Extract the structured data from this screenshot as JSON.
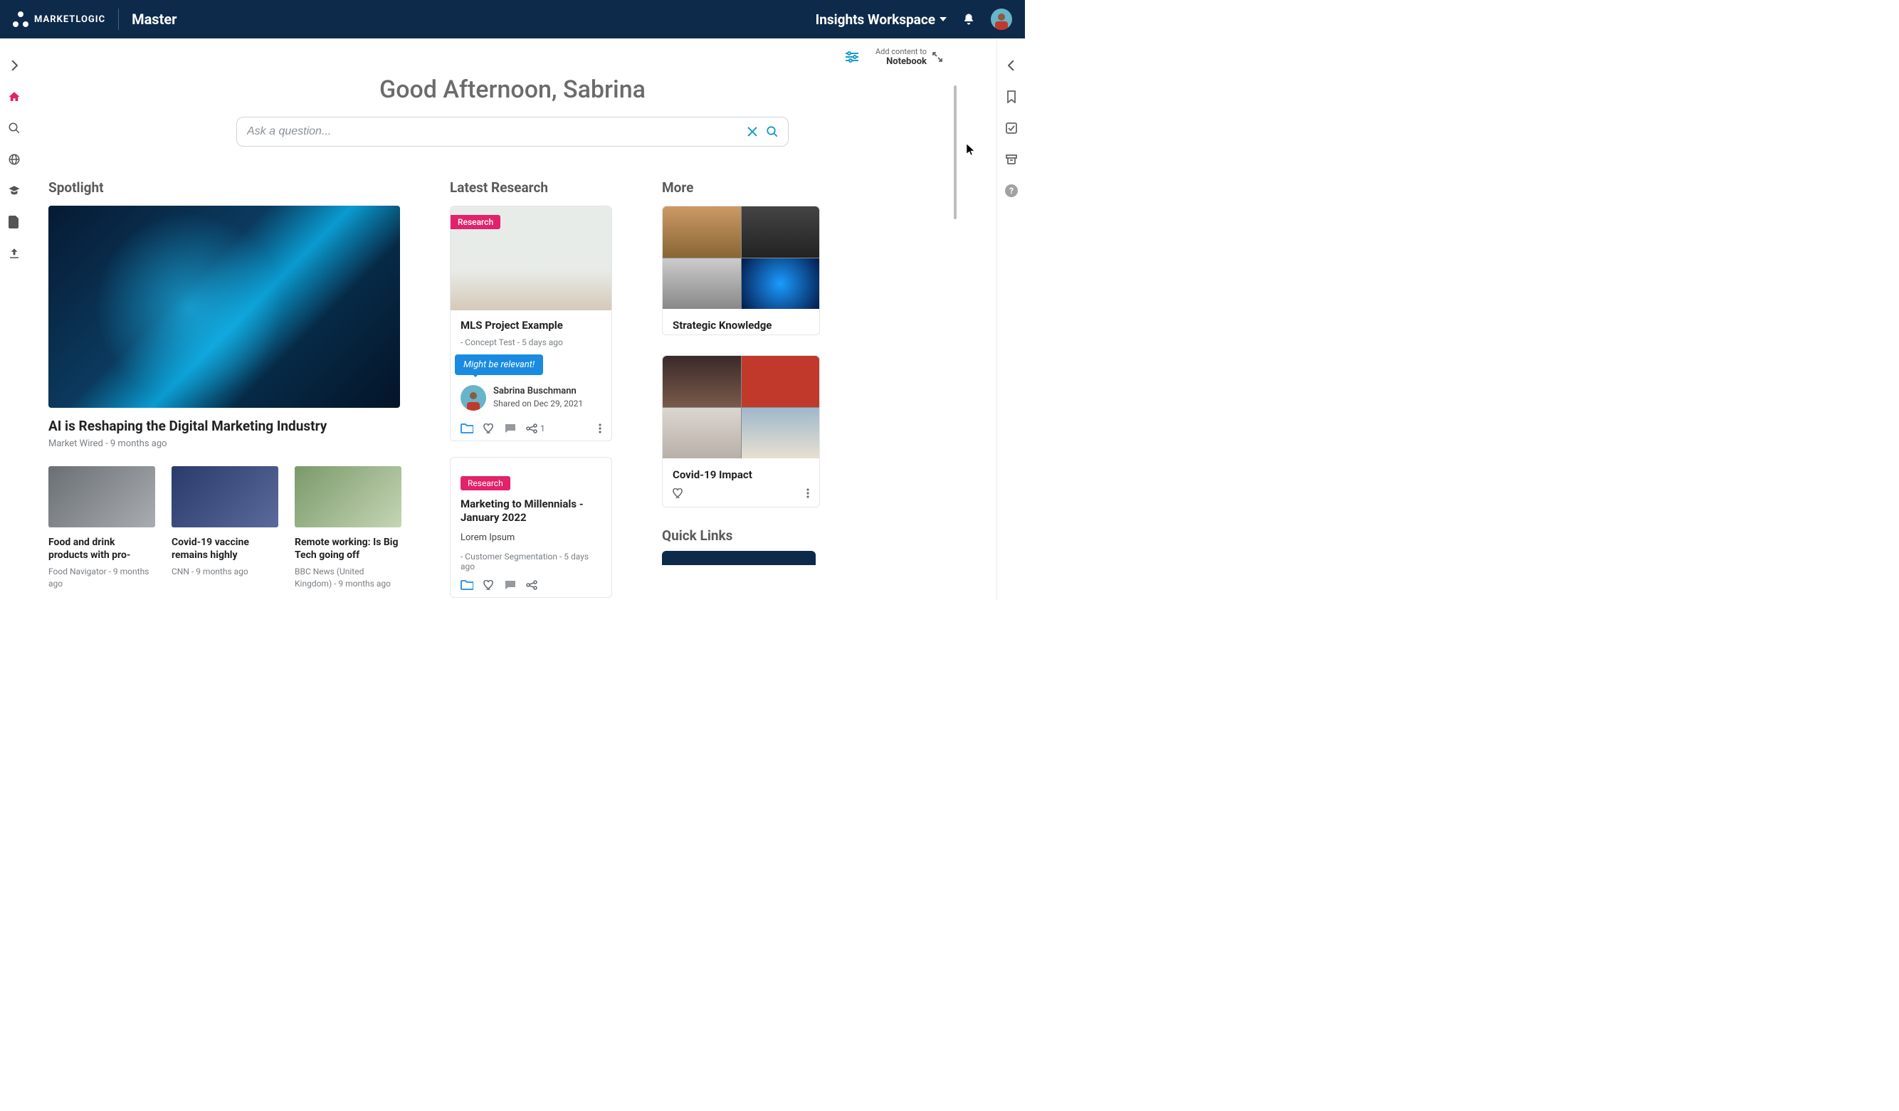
{
  "topbar": {
    "brand": "MARKETLOGIC",
    "master": "Master",
    "workspace": "Insights Workspace"
  },
  "notebook": {
    "line1": "Add content to",
    "line2": "Notebook"
  },
  "greeting": "Good Afternoon, Sabrina",
  "search": {
    "placeholder": "Ask a question..."
  },
  "sections": {
    "spotlight": "Spotlight",
    "latest": "Latest Research",
    "more": "More",
    "quicklinks": "Quick Links"
  },
  "hero": {
    "title": "AI is Reshaping the Digital Marketing Industry",
    "meta": "Market Wired - 9 months ago"
  },
  "spotlight_items": [
    {
      "title": "Food and drink products with pro-",
      "meta": "Food Navigator - 9 months ago"
    },
    {
      "title": "Covid-19 vaccine remains highly",
      "meta": "CNN - 9 months ago"
    },
    {
      "title": "Remote working: Is Big Tech going off",
      "meta": "BBC News (United Kingdom) - 9 months ago"
    }
  ],
  "research": [
    {
      "badge": "Research",
      "title": "MLS Project Example",
      "meta": "- Concept Test - 5 days ago",
      "tooltip": "Might be relevant!",
      "shared_name": "Sabrina Buschmann",
      "shared_meta": "Shared on Dec 29, 2021",
      "share_count": "1"
    },
    {
      "badge": "Research",
      "title": "Marketing to Millennials - January 2022",
      "desc": "Lorem Ipsum",
      "meta": "- Customer Segmentation - 5 days ago"
    }
  ],
  "more_cards": [
    {
      "title": "Strategic Knowledge"
    },
    {
      "title": "Covid-19 Impact"
    }
  ]
}
